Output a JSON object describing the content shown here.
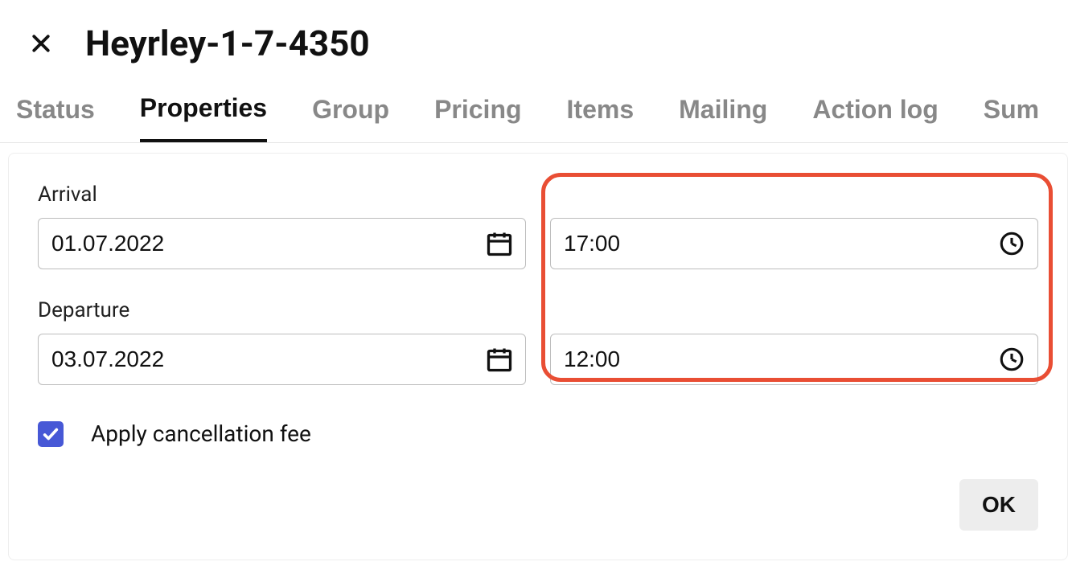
{
  "header": {
    "title": "Heyrley-1-7-4350"
  },
  "tabs": [
    {
      "label": "Status"
    },
    {
      "label": "Properties"
    },
    {
      "label": "Group"
    },
    {
      "label": "Pricing"
    },
    {
      "label": "Items"
    },
    {
      "label": "Mailing"
    },
    {
      "label": "Action log"
    },
    {
      "label": "Sum"
    }
  ],
  "active_tab": "Properties",
  "form": {
    "arrival": {
      "label": "Arrival",
      "date": "01.07.2022",
      "time": "17:00"
    },
    "departure": {
      "label": "Departure",
      "date": "03.07.2022",
      "time": "12:00"
    },
    "apply_fee": {
      "label": "Apply cancellation fee",
      "checked": true
    }
  },
  "buttons": {
    "ok": "OK"
  }
}
